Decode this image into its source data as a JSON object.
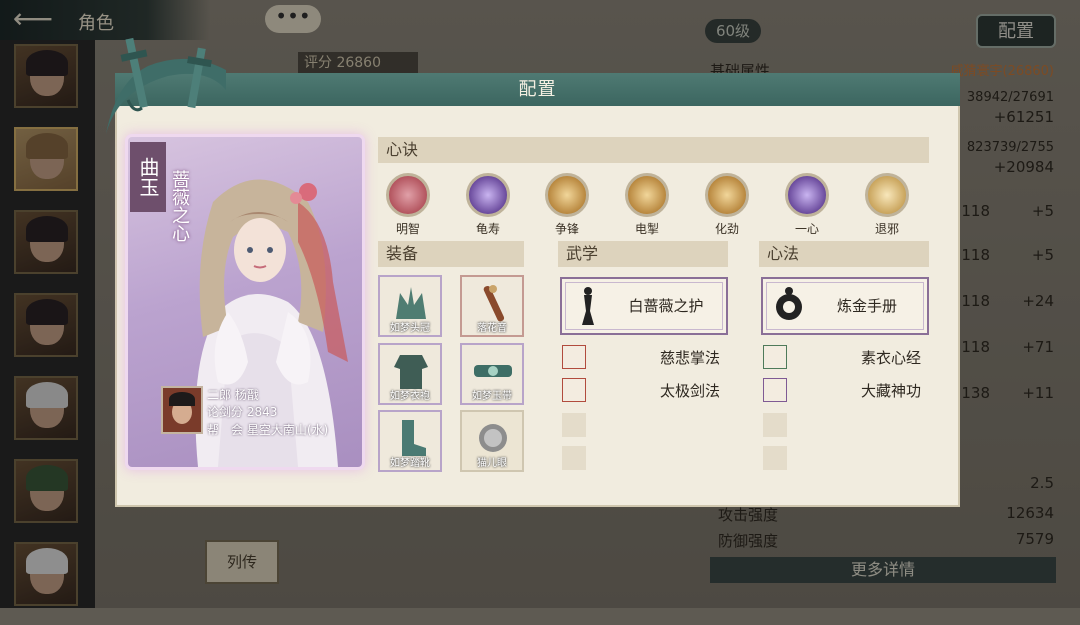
{
  "header": {
    "back_icon": "back-arrow-icon",
    "title": "角色"
  },
  "background": {
    "level": "60级",
    "config_button": "配置",
    "score_label": "评分",
    "score_value": "26860",
    "base_attr_label": "基础属性",
    "owner_partial": "威猜寰宇(26860)",
    "stats": [
      {
        "value": "38942/27691",
        "sub": "+61251"
      },
      {
        "value": "823739/2755",
        "sub": "+20984"
      },
      {
        "value": "118",
        "sub": "+5"
      },
      {
        "value": "118",
        "sub": "+5"
      },
      {
        "value": "118",
        "sub": "+24"
      },
      {
        "value": "118",
        "sub": "+71"
      },
      {
        "value": "138",
        "sub": "+11"
      }
    ],
    "bottom_stats": [
      {
        "label": "",
        "value": "2.5"
      },
      {
        "label": "攻击强度",
        "value": "12634"
      },
      {
        "label": "防御强度",
        "value": "7579"
      }
    ],
    "more_detail": "更多详情",
    "biography_button": "列传"
  },
  "modal": {
    "title": "配置",
    "card": {
      "character_name": "曲玉",
      "skin_name": "蔷薇之心",
      "owner": {
        "name_line": "二郎 杨戬",
        "score_line": "论剑分 2843",
        "guild_line": "帮　会 星空大南山(水)"
      }
    },
    "sections": {
      "xinjue": "心诀",
      "equipment": "装备",
      "martial": "武学",
      "mental": "心法"
    },
    "xinjue_items": [
      {
        "label": "明智",
        "icon": "wisdom-icon",
        "color": "#b3545e"
      },
      {
        "label": "龟寿",
        "icon": "turtle-longevity-icon",
        "color": "#6a4a9c"
      },
      {
        "label": "争锋",
        "icon": "contention-icon",
        "color": "#b8873e"
      },
      {
        "label": "电掣",
        "icon": "lightning-icon",
        "color": "#b8873e"
      },
      {
        "label": "化劲",
        "icon": "transform-force-icon",
        "color": "#b8873e"
      },
      {
        "label": "一心",
        "icon": "single-heart-icon",
        "color": "#6a4a9c"
      },
      {
        "label": "退邪",
        "icon": "repel-evil-icon",
        "color": "#c9a45c"
      }
    ],
    "equipment": [
      {
        "label": "如梦头冠",
        "icon": "crown-icon"
      },
      {
        "label": "落花音",
        "icon": "flute-icon"
      },
      {
        "label": "如梦衣袍",
        "icon": "robe-icon"
      },
      {
        "label": "如梦玉带",
        "icon": "jade-belt-icon"
      },
      {
        "label": "如梦踏靴",
        "icon": "boots-icon"
      },
      {
        "label": "猫儿眼",
        "icon": "gem-icon"
      }
    ],
    "martial": {
      "main": "白蔷薇之护",
      "items": [
        "慈悲掌法",
        "太极剑法"
      ]
    },
    "mental": {
      "main": "炼金手册",
      "items": [
        "素衣心经",
        "大藏神功"
      ]
    }
  }
}
